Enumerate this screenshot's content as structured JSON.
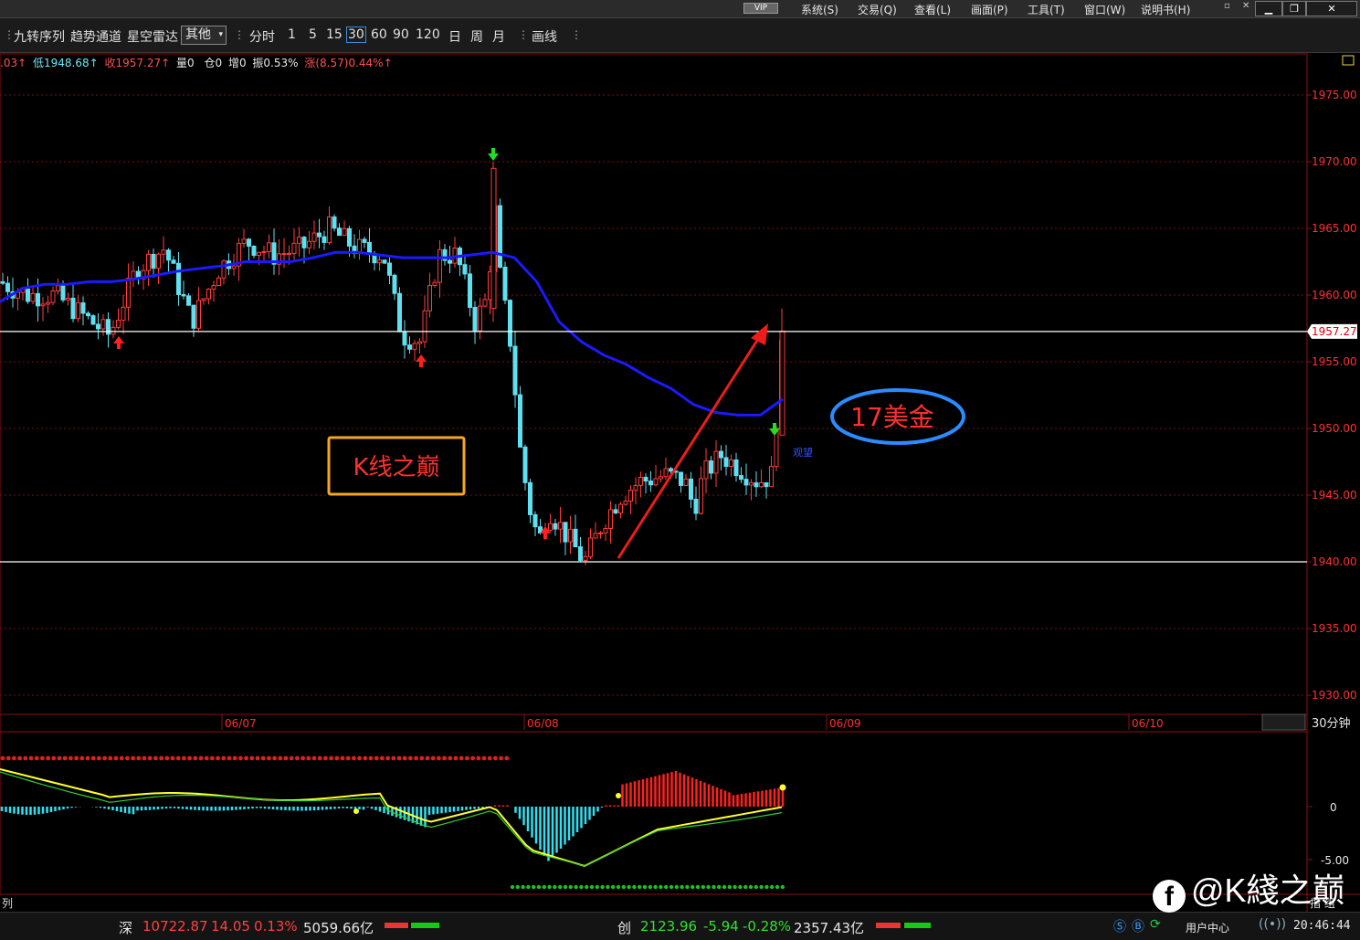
{
  "titlebar": {
    "vip": "VIP",
    "menu": [
      "系统(S)",
      "交易(Q)",
      "查看(L)",
      "画面(P)",
      "工具(T)",
      "窗口(W)",
      "说明书(H)"
    ]
  },
  "toolbar": {
    "items": [
      "九转序列",
      "趋势通道",
      "星空雷达"
    ],
    "select_value": "其他",
    "fen_shi": "分时",
    "periods": [
      "1",
      "5",
      "15",
      "30",
      "60",
      "90",
      "120",
      "日",
      "周",
      "月"
    ],
    "active_period": "30",
    "draw": "画线"
  },
  "info": {
    "high_tail": ".03↑",
    "low": "低1948.68↑",
    "close": "收1957.27↑",
    "volume": "量0",
    "oi": "仓0",
    "inc": "增0",
    "amp": "振0.53%",
    "change": "涨(8.57)0.44%↑"
  },
  "price_axis": [
    "1975.00",
    "1970.00",
    "1965.00",
    "1960.00",
    "1955.00",
    "1950.00",
    "1945.00",
    "1940.00",
    "1935.00",
    "1930.00"
  ],
  "current_price": "1957.27",
  "date_labels": [
    "06/07",
    "06/08",
    "06/09",
    "06/10"
  ],
  "period_label": "30分钟",
  "macd_axis": [
    "0",
    "-5.00"
  ],
  "annotations": {
    "brand_box": "K线之巅",
    "oval_text": "17美金",
    "signal_text": "观望"
  },
  "left_stub": "列",
  "right_stub": "指 组",
  "bottom": {
    "shen_label": "深",
    "shen_value": "10722.87",
    "shen_change": "14.05",
    "shen_pct": "0.13%",
    "shen_amount": "5059.66亿",
    "chuang_label": "创",
    "chuang_value": "2123.96",
    "chuang_change": "-5.94",
    "chuang_pct": "-0.28%",
    "chuang_amount": "2357.43亿",
    "user_center": "用户中心",
    "clock": "20:46:44"
  },
  "watermark": "@K綫之巅",
  "colors": {
    "up": "#ff3b3b",
    "down": "#5ee0f0",
    "ma": "#1a1aff",
    "grid": "#8a1010"
  },
  "chart_data": {
    "type": "candlestick",
    "ylim": [
      1929,
      1978
    ],
    "ma_line": [
      1959.5,
      1960.5,
      1960.8,
      1960.8,
      1961.0,
      1961.0,
      1961.2,
      1961.5,
      1961.8,
      1962.0,
      1962.2,
      1962.5,
      1962.5,
      1962.5,
      1962.8,
      1963.2,
      1963.2,
      1963.0,
      1962.8,
      1962.8,
      1962.8,
      1963.0,
      1963.2,
      1962.8,
      1961.0,
      1958.0,
      1956.5,
      1955.5,
      1954.8,
      1953.8,
      1953.0,
      1951.8,
      1951.2,
      1951.0,
      1951.0,
      1952.2
    ],
    "annotated_levels": [
      1957.27,
      1940.0
    ]
  }
}
